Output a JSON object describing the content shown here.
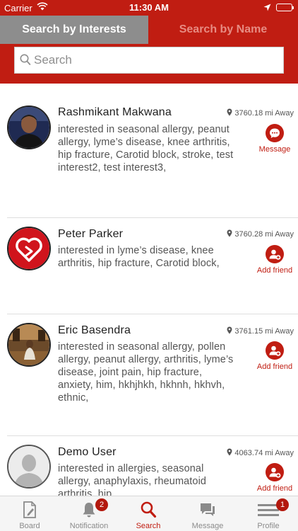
{
  "status_bar": {
    "carrier": "Carrier",
    "time": "11:30 AM"
  },
  "tabs": {
    "active": "Search by Interests",
    "inactive": "Search by Name"
  },
  "search": {
    "placeholder": "Search"
  },
  "people": [
    {
      "name": "Rashmikant Makwana",
      "distance": "3760.18 mi Away",
      "interests": "interested in seasonal allergy, peanut allergy, lyme’s disease, knee arthritis, hip fracture, Carotid block, stroke, test interest2, test interest3,",
      "action": "Message",
      "avatar": "photo"
    },
    {
      "name": "Peter Parker",
      "distance": "3760.28 mi Away",
      "interests": "interested in lyme’s disease, knee arthritis, hip fracture, Carotid block,",
      "action": "Add friend",
      "avatar": "heart-logo"
    },
    {
      "name": "Eric Basendra",
      "distance": "3761.15 mi Away",
      "interests": "interested in seasonal allergy, pollen allergy, peanut allergy, arthritis, lyme’s disease, joint pain, hip fracture, anxiety, him, hkhjhkh, hkhnh, hkhvh, ethnic,",
      "action": "Add friend",
      "avatar": "photo"
    },
    {
      "name": "Demo User",
      "distance": "4063.74 mi Away",
      "interests": "interested in allergies, seasonal allergy, anaphylaxis, rheumatoid arthritis, hip",
      "action": "Add friend",
      "avatar": "placeholder"
    }
  ],
  "tabbar": [
    {
      "label": "Board",
      "icon": "board-icon"
    },
    {
      "label": "Notification",
      "icon": "bell-icon",
      "badge": "2"
    },
    {
      "label": "Search",
      "icon": "search-icon",
      "active": true
    },
    {
      "label": "Message",
      "icon": "chat-icon"
    },
    {
      "label": "Profile",
      "icon": "menu-icon",
      "badge": "1"
    }
  ],
  "colors": {
    "brand": "#c01d12",
    "active_tab": "#8d8d8d"
  }
}
